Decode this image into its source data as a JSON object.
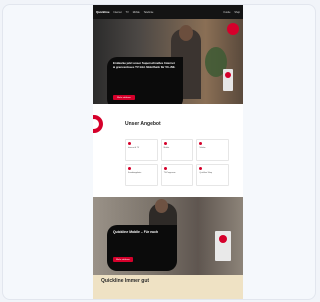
{
  "nav": {
    "logo": "Quickline",
    "items": [
      "Internet",
      "TV",
      "Mobile",
      "Telefonie"
    ],
    "right_items": [
      "Kunde",
      "Shop"
    ]
  },
  "hero": {
    "title": "Entdecke jetzt unser Superschnelles Internet & grenzenloses TV Inkl. Mobilfunk für 50.-/Mt.",
    "cta": "Mehr erfahren"
  },
  "offer": {
    "title": "Unser Angebot",
    "tiles": [
      "Internet & TV",
      "Mobile",
      "Telefon",
      "Kombiangebote",
      "TV-Programm",
      "Quickline Shop"
    ]
  },
  "promo": {
    "title": "Quickline Mobile – Für euch",
    "cta": "Mehr erfahren"
  },
  "bottom": {
    "title": "Quickline Immer gut"
  },
  "colors": {
    "brand_red": "#d5002b",
    "nav_bg": "#141414",
    "bottom_bg": "#efe2c4"
  }
}
